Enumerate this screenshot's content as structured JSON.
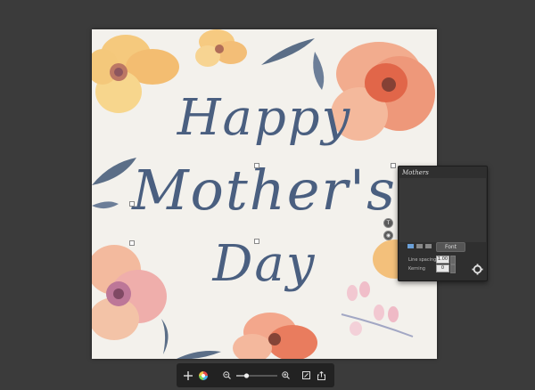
{
  "card": {
    "line1": "Happy",
    "line2": "Mother's",
    "line3": "Day"
  },
  "text_panel": {
    "title": "Mothers",
    "font_button": "Font",
    "line_spacing_label": "Line spacing",
    "line_spacing_value": "1.00",
    "kerning_label": "Kerning",
    "kerning_value": "0"
  },
  "toolbar": {
    "zoom_level": 0.25
  },
  "colors": {
    "background": "#3b3b3b",
    "text_ink": "#4a5f80",
    "accent": "#6aa0d8"
  }
}
